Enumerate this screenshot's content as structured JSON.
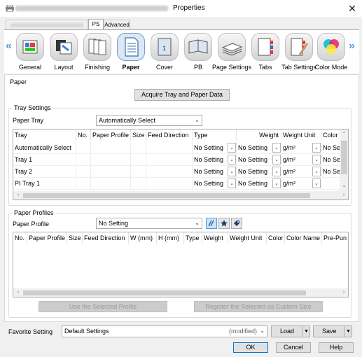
{
  "window": {
    "title": "Properties",
    "close_glyph": "✕"
  },
  "tabs": [
    {
      "label": "",
      "blurred": true
    },
    {
      "label": "PS",
      "active": true
    },
    {
      "label": "Advanced"
    }
  ],
  "toolbar": {
    "left_arrow": "«",
    "right_arrow": "»",
    "items": [
      {
        "label": "General",
        "icon": "general-icon"
      },
      {
        "label": "Layout",
        "icon": "layout-icon"
      },
      {
        "label": "Finishing",
        "icon": "finishing-icon"
      },
      {
        "label": "Paper",
        "icon": "paper-icon",
        "selected": true
      },
      {
        "label": "Cover",
        "icon": "cover-icon"
      },
      {
        "label": "PB",
        "icon": "perfect-binding-icon"
      },
      {
        "label": "Page Settings",
        "icon": "page-settings-icon"
      },
      {
        "label": "Tabs",
        "icon": "tabs-icon"
      },
      {
        "label": "Tab Settings",
        "icon": "tab-settings-icon"
      },
      {
        "label": "Color Mode",
        "icon": "color-mode-icon"
      }
    ]
  },
  "paper_section": {
    "group_label": "Paper",
    "acquire_button": "Acquire Tray and Paper Data"
  },
  "tray_settings": {
    "group_label": "Tray Settings",
    "paper_tray_label": "Paper Tray",
    "paper_tray_value": "Automatically Select",
    "columns": [
      "Tray",
      "No.",
      "Paper Profile",
      "Size",
      "Feed Direction",
      "Type",
      "Weight",
      "Weight Unit",
      "Color"
    ],
    "rows": [
      {
        "tray": "Automatically Select",
        "no": "",
        "profile": "",
        "size": "",
        "feed": "",
        "type": "No Setting",
        "weight": "No Setting",
        "unit": "g/m²",
        "color": "No Se"
      },
      {
        "tray": "Tray 1",
        "no": "",
        "profile": "",
        "size": "",
        "feed": "",
        "type": "No Setting",
        "weight": "No Setting",
        "unit": "g/m²",
        "color": "No Se"
      },
      {
        "tray": "Tray 2",
        "no": "",
        "profile": "",
        "size": "",
        "feed": "",
        "type": "No Setting",
        "weight": "No Setting",
        "unit": "g/m²",
        "color": "No Se"
      },
      {
        "tray": "PI Tray 1",
        "no": "",
        "profile": "",
        "size": "",
        "feed": "",
        "type": "No Setting",
        "weight": "No Setting",
        "unit": "g/m²",
        "color": ""
      },
      {
        "tray": "PI Tray 2",
        "no": "",
        "profile": "",
        "size": "",
        "feed": "",
        "type": "No Setting",
        "weight": "No Setting",
        "unit": "g/m²",
        "color": ""
      }
    ]
  },
  "paper_profiles": {
    "group_label": "Paper Profiles",
    "profile_label": "Paper Profile",
    "profile_value": "No Setting",
    "columns": [
      "No.",
      "Paper Profile",
      "Size",
      "Feed Direction",
      "W (mm)",
      "H (mm)",
      "Type",
      "Weight",
      "Weight Unit",
      "Color",
      "Color Name",
      "Pre-Pun"
    ],
    "use_selected_button": "Use the Selected Profile",
    "register_button": "Register the Selected as Custom Size"
  },
  "favorite": {
    "label": "Favorite Setting",
    "value": "Default Settings",
    "modified": "(modified)",
    "load_button": "Load",
    "save_button": "Save"
  },
  "footer": {
    "ok": "OK",
    "cancel": "Cancel",
    "help": "Help"
  },
  "colors": {
    "accent": "#0078d7",
    "arrow_blue": "#5b9bd5",
    "selected_bg": "#dce8f5"
  }
}
